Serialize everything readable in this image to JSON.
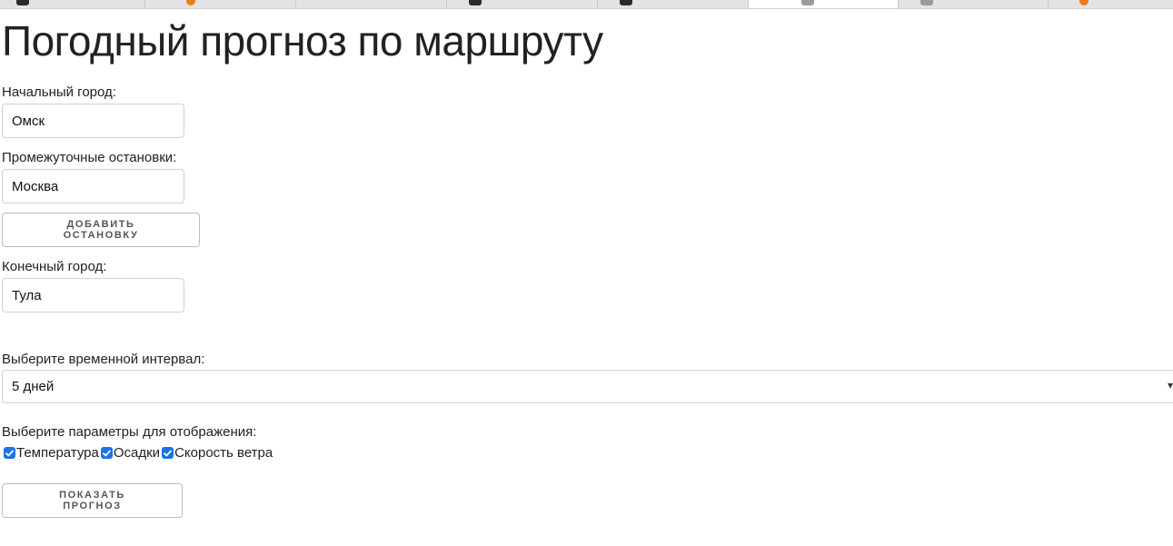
{
  "page": {
    "title": "Погодный прогноз по маршруту"
  },
  "form": {
    "start_label": "Начальный город:",
    "start_value": "Омск",
    "stops_label": "Промежуточные остановки:",
    "stops_value": "Москва",
    "add_stop_button": "ДОБАВИТЬ ОСТАНОВКУ",
    "end_label": "Конечный город:",
    "end_value": "Тула",
    "interval_label": "Выберите временной интервал:",
    "interval_value": "5 дней",
    "params_label": "Выберите параметры для отображения:",
    "params": [
      {
        "label": "Температура",
        "checked": true
      },
      {
        "label": "Осадки",
        "checked": true
      },
      {
        "label": "Скорость ветра",
        "checked": true
      }
    ],
    "show_button": "ПОКАЗАТЬ ПРОГНОЗ"
  },
  "colors": {
    "checkbox_accent": "#1a73e8",
    "browser_tab_bar": "#e3e3e6"
  },
  "icons": {
    "select_chevron": "chevron-down-icon",
    "checkbox_mark": "checkmark-icon"
  }
}
